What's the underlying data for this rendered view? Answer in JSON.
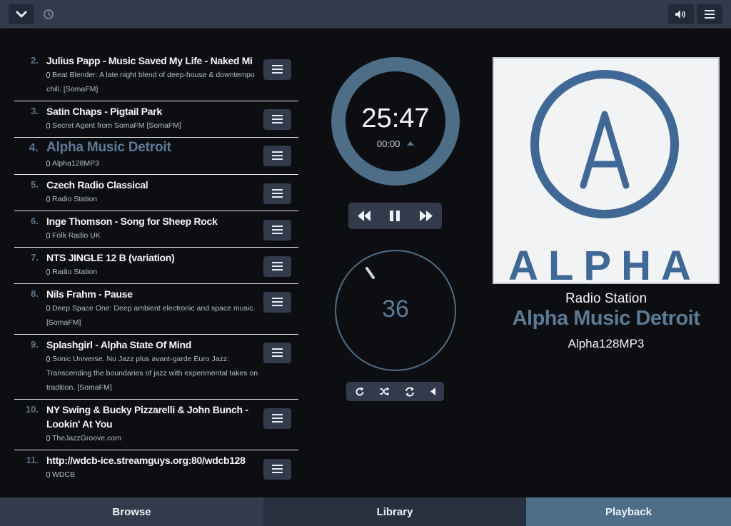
{
  "app": {
    "accent_color": "#5b7a96",
    "icons": {
      "collapse": "chevron-down-icon",
      "history": "clock-icon",
      "volume": "speaker-icon",
      "menu": "hamburger-icon"
    }
  },
  "queue": [
    {
      "number": "2.",
      "title": "Julius Papp - Music Saved My Life - Naked Mi",
      "subtitle": "Beat Blender: A late night blend of deep-house & downtempo chill. [SomaFM]"
    },
    {
      "number": "3.",
      "title": "Satin Chaps - Pigtail Park",
      "subtitle": "Secret Agent from SomaFM [SomaFM]"
    },
    {
      "number": "4.",
      "title": "Alpha Music Detroit",
      "subtitle": "Alpha128MP3"
    },
    {
      "number": "5.",
      "title": "Czech Radio Classical",
      "subtitle": "Radio Station"
    },
    {
      "number": "6.",
      "title": "Inge Thomson - Song for Sheep Rock",
      "subtitle": "Folk Radio UK"
    },
    {
      "number": "7.",
      "title": "NTS JINGLE 12 B (variation)",
      "subtitle": "Radio Station"
    },
    {
      "number": "8.",
      "title": "Nils Frahm - Pause",
      "subtitle": "Deep Space One: Deep ambient electronic and space music. [SomaFM]"
    },
    {
      "number": "9.",
      "title": "Splashgirl - Alpha State Of Mind",
      "subtitle": "Sonic Universe. Nu Jazz plus avant-garde Euro Jazz: Transcending the boundaries of jazz with experimental takes on tradition. [SomaFM]"
    },
    {
      "number": "10.",
      "title": "NY Swing & Bucky Pizzarelli & John Bunch - Lookin' At You",
      "subtitle": "TheJazzGroove.com"
    },
    {
      "number": "11.",
      "title": "http://wdcb-ice.streamguys.org:80/wdcb128",
      "subtitle": "WDCB"
    }
  ],
  "time_knob": {
    "elapsed": "25:47",
    "total": "00:00",
    "progress": 1.0
  },
  "volume_knob": {
    "level": "36",
    "fraction": 0.36
  },
  "transport": {
    "previous_icon": "rewind-icon",
    "pause_icon": "pause-icon",
    "next_icon": "fast-forward-icon"
  },
  "modes": {
    "repeat_icon": "repeat-icon",
    "shuffle_icon": "shuffle-icon",
    "consume_icon": "cycle-icon",
    "single_icon": "triangle-left-icon"
  },
  "now_playing": {
    "cover_text": "ALPHA",
    "cover_letter": "A",
    "artist": "Radio Station",
    "title": "Alpha Music Detroit",
    "album": "Alpha128MP3"
  },
  "tabs": [
    {
      "label": "Browse",
      "active": false
    },
    {
      "label": "Library",
      "active": false
    },
    {
      "label": "Playback",
      "active": true
    }
  ]
}
